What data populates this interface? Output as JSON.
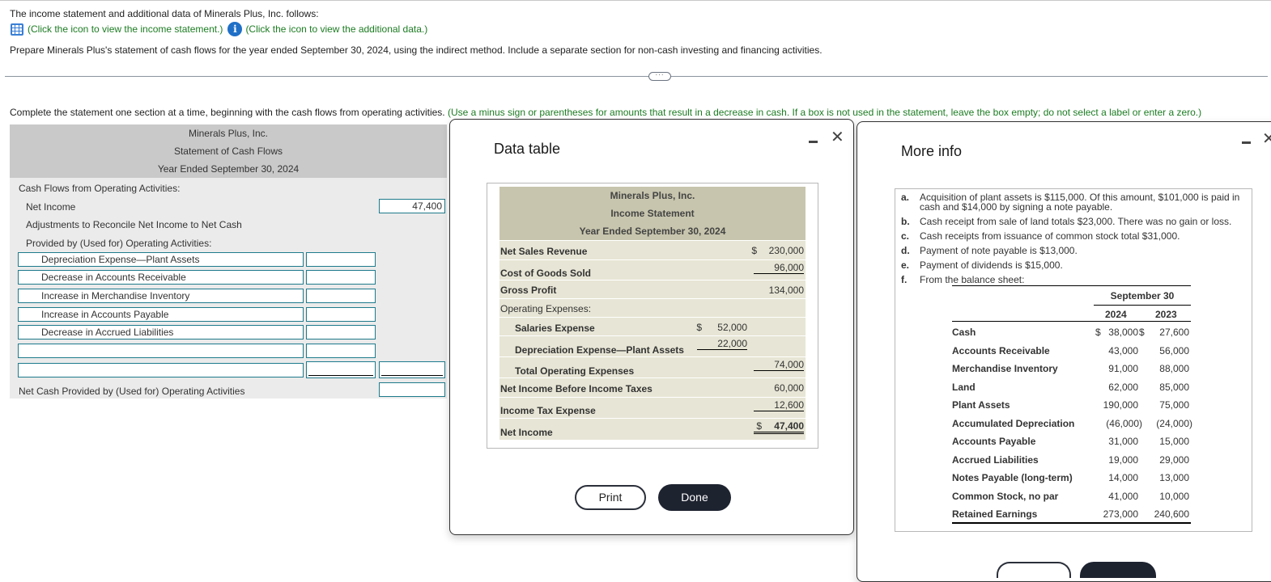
{
  "intro": {
    "text": "The income statement and additional data of Minerals Plus, Inc. follows:",
    "link_income": "(Click the icon to view the income statement.)",
    "link_additional": "(Click the icon to view the additional data.)",
    "icon_income": "table-grid-icon",
    "icon_additional": "info-icon",
    "prompt": "Prepare Minerals Plus's statement of cash flows for the year ended September 30, 2024, using the indirect method. Include a separate section for non-cash investing and financing activities.",
    "divider_handle": "···"
  },
  "instructions": {
    "main": "Complete the statement one section at a time, beginning with the cash flows from operating activities.",
    "note": "(Use a minus sign or parentheses for amounts that result in a decrease in cash. If a box is not used in the statement, leave the box empty; do not select a label or enter a zero.)"
  },
  "statement": {
    "company": "Minerals Plus, Inc.",
    "title": "Statement of Cash Flows",
    "period": "Year Ended September 30, 2024",
    "section_label": "Cash Flows from Operating Activities:",
    "net_income_label": "Net Income",
    "net_income_value": "47,400",
    "adjustments_label_1": "Adjustments to Reconcile Net Income to Net Cash",
    "adjustments_label_2": "Provided by (Used for) Operating Activities:",
    "adjustment_rows": [
      {
        "label": "Depreciation Expense—Plant Assets",
        "value": ""
      },
      {
        "label": "Decrease in Accounts Receivable",
        "value": ""
      },
      {
        "label": "Increase in Merchandise Inventory",
        "value": ""
      },
      {
        "label": "Increase in Accounts Payable",
        "value": ""
      },
      {
        "label": "Decrease in Accrued Liabilities",
        "value": ""
      },
      {
        "label": "",
        "value": ""
      },
      {
        "label": "",
        "value": "",
        "total": ""
      }
    ],
    "net_cash_label": "Net Cash Provided by (Used for) Operating Activities",
    "net_cash_value": ""
  },
  "data_table_dialog": {
    "title": "Data table",
    "minimize_icon": "minimize-icon",
    "close_icon": "close-icon",
    "income_statement": {
      "company": "Minerals Plus, Inc.",
      "title": "Income Statement",
      "period": "Year Ended September 30, 2024",
      "rows": [
        {
          "label": "Net Sales Revenue",
          "col1": "",
          "col2": "230,000",
          "sym2": "$"
        },
        {
          "label": "Cost of Goods Sold",
          "col1": "",
          "col2": "96,000"
        },
        {
          "label": "Gross Profit",
          "col1": "",
          "col2": "134,000"
        },
        {
          "label": "Operating Expenses:",
          "col1": "",
          "col2": ""
        },
        {
          "label": "Salaries Expense",
          "col1": "52,000",
          "sym1": "$",
          "col2": ""
        },
        {
          "label": "Depreciation Expense—Plant Assets",
          "col1": "22,000",
          "col2": ""
        },
        {
          "label": "Total Operating Expenses",
          "col1": "",
          "col2": "74,000"
        },
        {
          "label": "Net Income Before Income Taxes",
          "col1": "",
          "col2": "60,000"
        },
        {
          "label": "Income Tax Expense",
          "col1": "",
          "col2": "12,600"
        },
        {
          "label": "Net Income",
          "col1": "",
          "col2": "47,400",
          "sym2": "$"
        }
      ]
    },
    "print_label": "Print",
    "done_label": "Done"
  },
  "more_info_dialog": {
    "title": "More info",
    "minimize_icon": "minimize-icon",
    "close_icon": "close-icon",
    "items": [
      {
        "letter": "a.",
        "text": "Acquisition of plant assets is $115,000. Of this amount, $101,000 is paid in cash and $14,000 by signing a note payable."
      },
      {
        "letter": "b.",
        "text": "Cash receipt from sale of land totals $23,000. There was no gain or loss."
      },
      {
        "letter": "c.",
        "text": "Cash receipts from issuance of common stock total $31,000."
      },
      {
        "letter": "d.",
        "text": "Payment of note payable is $13,000."
      },
      {
        "letter": "e.",
        "text": "Payment of dividends is $15,000."
      },
      {
        "letter": "f.",
        "text": "From the balance sheet:"
      }
    ],
    "balance_sheet": {
      "header": "September 30",
      "years": [
        "2024",
        "2023"
      ],
      "rows": [
        {
          "label": "Cash",
          "y2024": "38,000",
          "y2023": "27,600",
          "dollar": "$"
        },
        {
          "label": "Accounts Receivable",
          "y2024": "43,000",
          "y2023": "56,000"
        },
        {
          "label": "Merchandise Inventory",
          "y2024": "91,000",
          "y2023": "88,000"
        },
        {
          "label": "Land",
          "y2024": "62,000",
          "y2023": "85,000"
        },
        {
          "label": "Plant Assets",
          "y2024": "190,000",
          "y2023": "75,000"
        },
        {
          "label": "Accumulated Depreciation",
          "y2024": "(46,000)",
          "y2023": "(24,000)"
        },
        {
          "label": "Accounts Payable",
          "y2024": "31,000",
          "y2023": "15,000"
        },
        {
          "label": "Accrued Liabilities",
          "y2024": "19,000",
          "y2023": "29,000"
        },
        {
          "label": "Notes Payable (long-term)",
          "y2024": "14,000",
          "y2023": "13,000"
        },
        {
          "label": "Common Stock, no par",
          "y2024": "41,000",
          "y2023": "10,000"
        },
        {
          "label": "Retained Earnings",
          "y2024": "273,000",
          "y2023": "240,600"
        }
      ]
    }
  }
}
